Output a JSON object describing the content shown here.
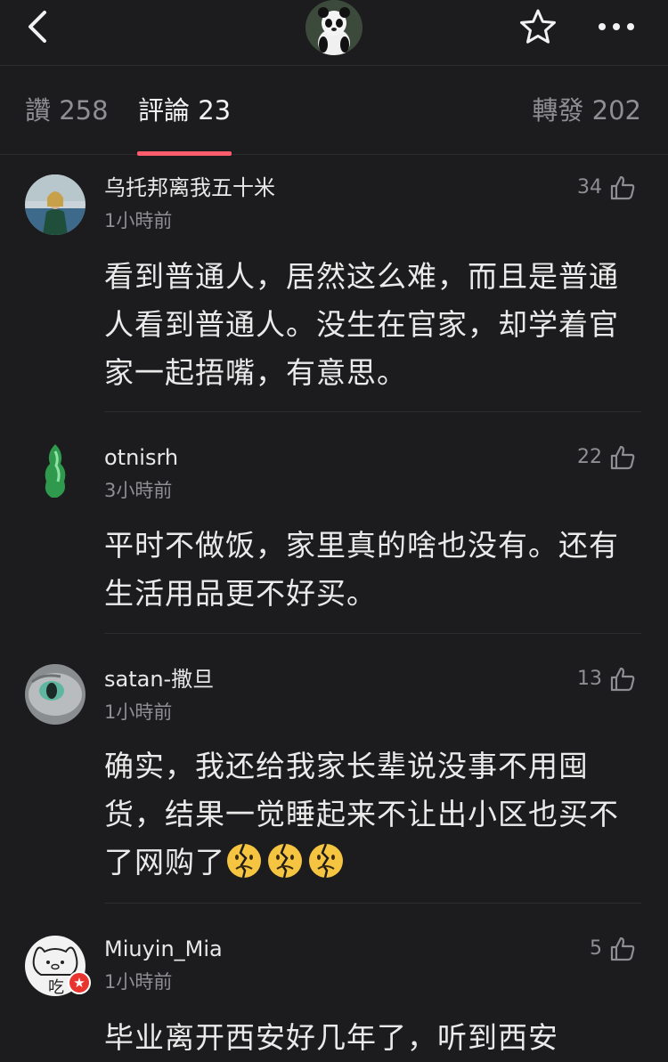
{
  "header": {
    "back_icon": "chevron-left-icon",
    "avatar_icon": "panda-avatar",
    "favorite_icon": "star-outline-icon",
    "more_icon": "more-dots-icon"
  },
  "tabs": [
    {
      "label": "讚 258",
      "active": false
    },
    {
      "label": "評論 23",
      "active": true
    },
    {
      "label": "轉發 202",
      "active": false
    }
  ],
  "accent_color": "#ff5d6c",
  "comments": [
    {
      "username": "乌托邦离我五十米",
      "time": "1小時前",
      "likes": "34",
      "text": "看到普通人，居然这么难，而且是普通人看到普通人。没生在官家，却学着官家一起捂嘴，有意思。"
    },
    {
      "username": "otnisrh",
      "time": "3小時前",
      "likes": "22",
      "text": "平时不做饭，家里真的啥也没有。还有生活用品更不好买。"
    },
    {
      "username": "satan-撒旦",
      "time": "1小時前",
      "likes": "13",
      "text": "确实，我还给我家长辈说没事不用囤货，结果一觉睡起来不让出小区也买不了网购了",
      "emoji": "broken-heart-face-emoji"
    },
    {
      "username": "Miuyin_Mia",
      "time": "1小時前",
      "likes": "5",
      "text": "毕业离开西安好几年了，听到西安",
      "avatar_text": "吃",
      "badge_icon": "star-badge-icon"
    }
  ]
}
